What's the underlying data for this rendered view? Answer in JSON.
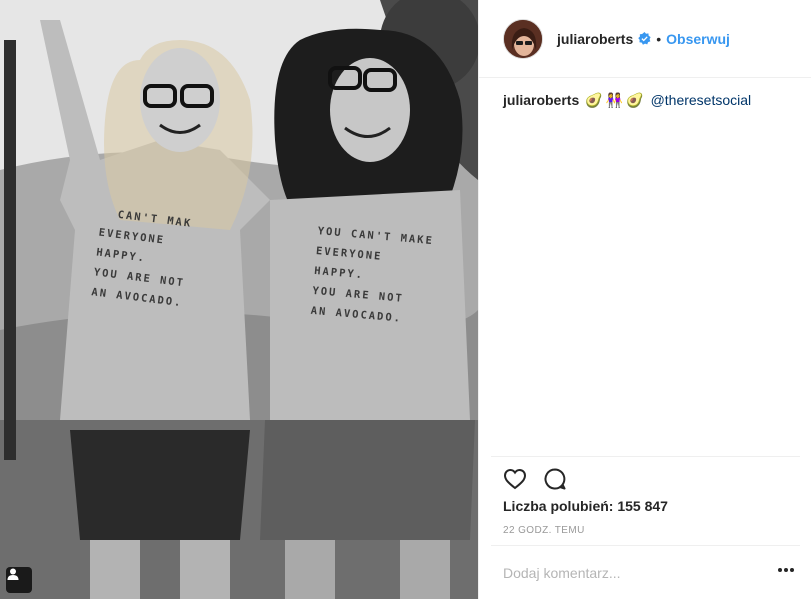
{
  "post": {
    "username": "juliaroberts",
    "follow_label": "Obserwuj",
    "separator": "•",
    "caption": {
      "username": "juliaroberts",
      "emojis": [
        "🥑",
        "👭",
        "🥑"
      ],
      "mention": "@theresetsocial"
    },
    "likes_text": "Liczba polubień: 155 847",
    "time_text": "22 GODZ. TEMU",
    "comment_placeholder": "Dodaj komentarz...",
    "shirt_text_left": "  CAN'T MAK\nEVERYONE\nHAPPY.\nYOU ARE NOT\nAN AVOCADO.",
    "shirt_text_right": "YOU CAN'T MAKE\nEVERYONE\nHAPPY.\nYOU ARE NOT\nAN AVOCADO."
  },
  "icons": {
    "verified": "verified-badge-icon",
    "like": "heart-icon",
    "comment": "comment-bubble-icon",
    "more": "more-options-icon",
    "tag": "user-tag-icon"
  },
  "colors": {
    "link_blue": "#3897f0",
    "verified_blue": "#3897f0",
    "text": "#262626",
    "muted": "#999999",
    "divider": "#efefef"
  }
}
